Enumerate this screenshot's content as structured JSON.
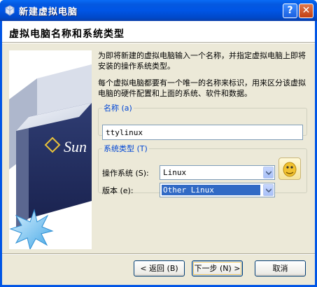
{
  "window": {
    "title": "新建虚拟电脑",
    "help_glyph": "?",
    "close_glyph": "✕"
  },
  "header": {
    "title": "虚拟电脑名称和系统类型"
  },
  "description": {
    "line1": "为即将新建的虚拟电脑输入一个名称，并指定虚拟电脑上即将安装的操作系统类型。",
    "line2": "每个虚拟电脑都要有一个唯一的名称来标识，用来区分该虚拟电脑的硬件配置和上面的系统、软件和数据。"
  },
  "name_group": {
    "legend": "名称 (a)",
    "value": "ttylinux"
  },
  "type_group": {
    "legend": "系统类型 (T)",
    "os_label": "操作系统 (S):",
    "os_value": "Linux",
    "version_label": "版本 (e):",
    "version_value": "Other Linux"
  },
  "buttons": {
    "back": "< 返回 (B)",
    "next": "下一步 (N) >",
    "cancel": "取消"
  },
  "logo_text": "Sun",
  "colors": {
    "titlebar": "#0055e5",
    "dialog_bg": "#ece9d8",
    "selection": "#316ac5"
  }
}
